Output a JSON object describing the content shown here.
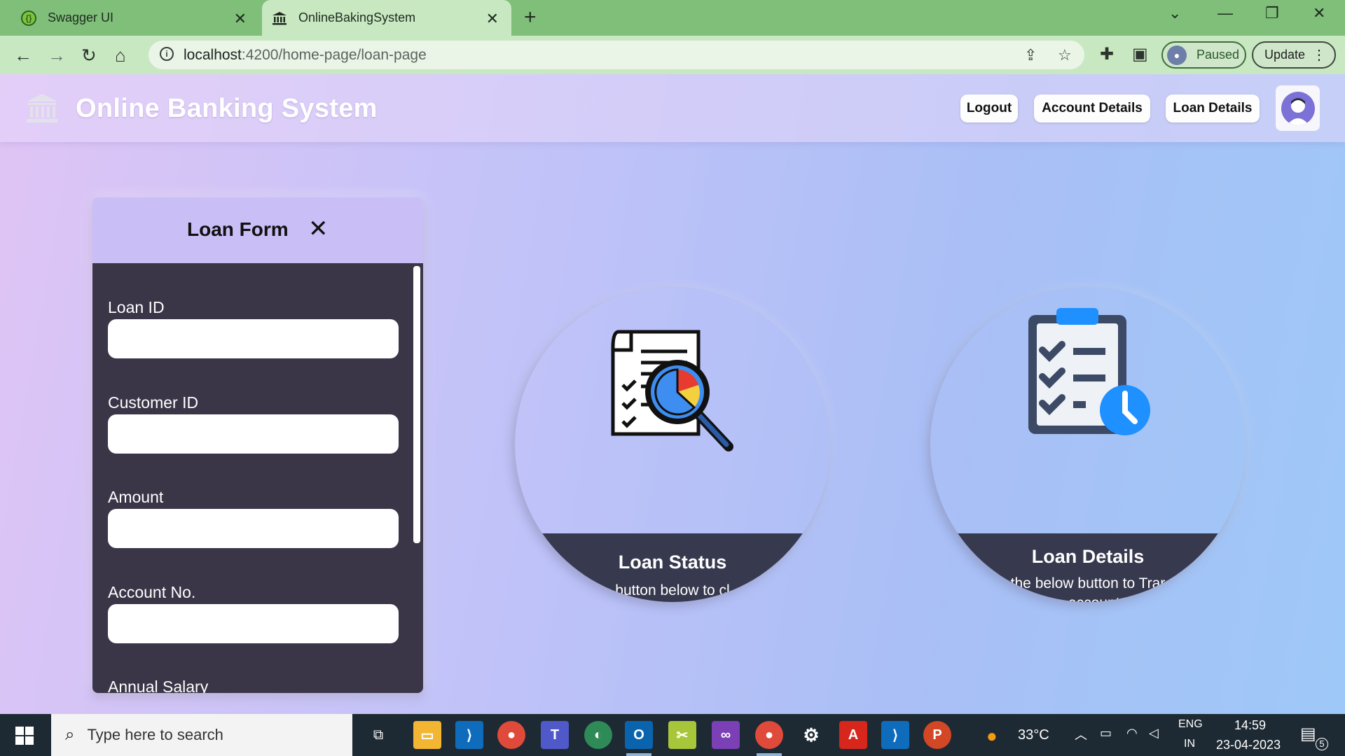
{
  "browser": {
    "tabs": [
      {
        "label": "Swagger UI",
        "active": false
      },
      {
        "label": "OnlineBakingSystem",
        "active": true
      }
    ],
    "url_host": "localhost",
    "url_path": ":4200/home-page/loan-page",
    "profile_status": "Paused",
    "update_label": "Update"
  },
  "app": {
    "title": "Online Banking System",
    "nav": {
      "logout": "Logout",
      "account_details": "Account Details",
      "loan_details": "Loan Details"
    }
  },
  "loan_form": {
    "title": "Loan Form",
    "fields": [
      {
        "label": "Loan ID",
        "value": ""
      },
      {
        "label": "Customer ID",
        "value": ""
      },
      {
        "label": "Amount",
        "value": ""
      },
      {
        "label": "Account No.",
        "value": ""
      },
      {
        "label": "Annual Salary",
        "value": ""
      }
    ]
  },
  "cards": {
    "loan_status": {
      "title": "Loan Status",
      "subtitle": "button below to cl"
    },
    "loan_details": {
      "title": "Loan Details",
      "subtitle": "the below button to Trar",
      "subtitle2": "e account"
    }
  },
  "taskbar": {
    "search_placeholder": "Type here to search",
    "weather": "33°C",
    "lang_top": "ENG",
    "lang_bottom": "IN",
    "time": "14:59",
    "date": "23-04-2023",
    "notification_count": "5"
  },
  "colors": {
    "tab_strip": "#7fbf7a",
    "page_gradient_start": "#dfc4f5",
    "page_gradient_end": "#9ec8f7",
    "form_body": "#3b3548",
    "card_band": "#37394e",
    "taskbar": "#1e2a33"
  }
}
